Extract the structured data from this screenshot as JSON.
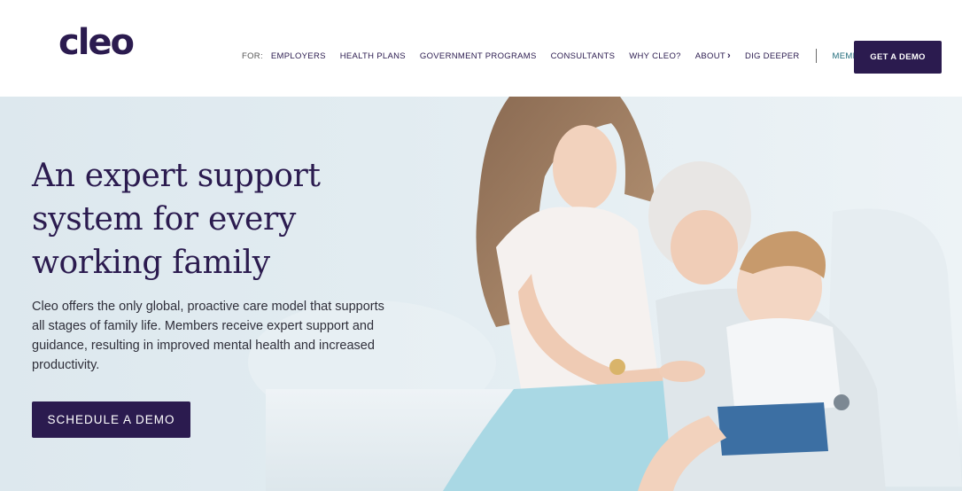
{
  "header": {
    "logo": "cleo",
    "nav": {
      "for_label": "FOR:",
      "links": [
        "EMPLOYERS",
        "HEALTH PLANS",
        "GOVERNMENT PROGRAMS",
        "CONSULTANTS",
        "WHY CLEO?",
        "ABOUT",
        "DIG DEEPER"
      ],
      "about_icon": "chevron-right-icon",
      "member_login": "MEMBER LOGIN"
    },
    "cta": "GET A DEMO"
  },
  "hero": {
    "headline": "An expert support system for every working family",
    "body": "Cleo offers the only global, proactive care model that supports all stages of family life. Members receive expert support and guidance, resulting in improved mental health and increased productivity.",
    "cta": "SCHEDULE A DEMO",
    "image": "photo of a mother, grandmother and baby high-fiving on a couch"
  },
  "colors": {
    "brand": "#2b1b4f",
    "link_teal": "#1f6a7a",
    "hero_bg": "#e2ecf1"
  }
}
